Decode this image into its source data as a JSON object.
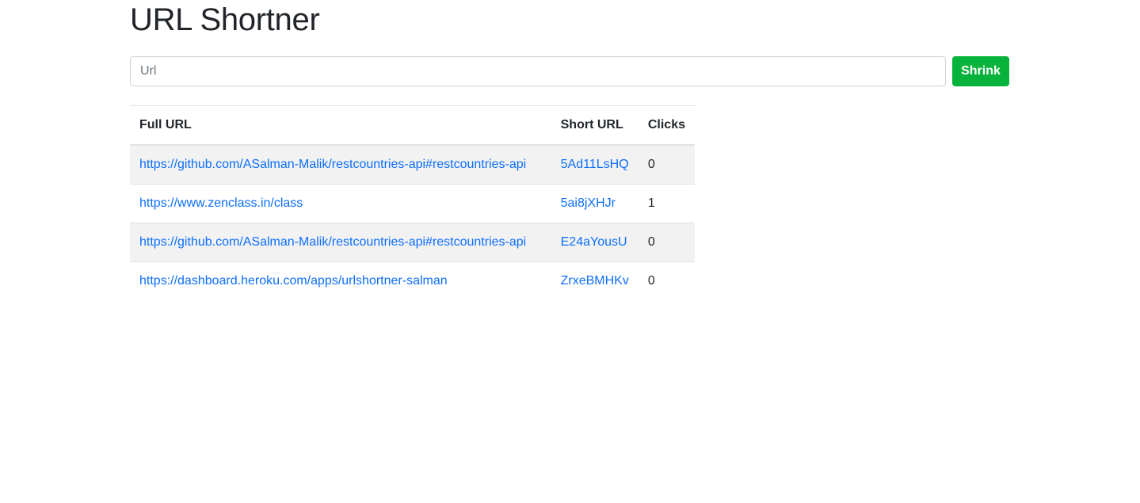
{
  "header": {
    "title": "URL Shortner"
  },
  "form": {
    "url_placeholder": "Url",
    "url_value": "",
    "shrink_label": "Shrink",
    "accent_color": "#08b33b"
  },
  "table": {
    "columns": [
      "Full URL",
      "Short URL",
      "Clicks"
    ],
    "rows": [
      {
        "full": "https://github.com/ASalman-Malik/restcountries-api#restcountries-api",
        "short": "5Ad11LsHQ",
        "clicks": "0"
      },
      {
        "full": "https://www.zenclass.in/class",
        "short": "5ai8jXHJr",
        "clicks": "1"
      },
      {
        "full": "https://github.com/ASalman-Malik/restcountries-api#restcountries-api",
        "short": "E24aYousU",
        "clicks": "0"
      },
      {
        "full": "https://dashboard.heroku.com/apps/urlshortner-salman",
        "short": "ZrxeBMHKv",
        "clicks": "0"
      }
    ],
    "link_color": "#0d6efd"
  }
}
